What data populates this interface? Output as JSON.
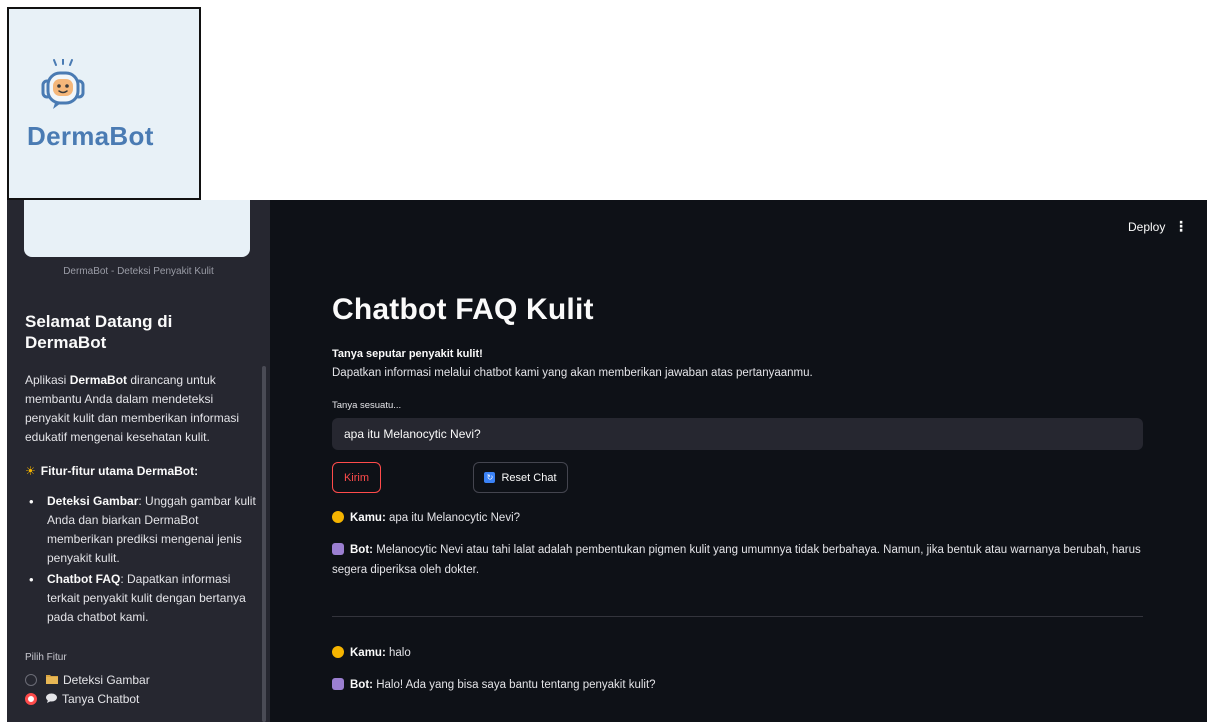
{
  "logo": {
    "text": "DermaBot"
  },
  "sidebar": {
    "caption": "DermaBot - Deteksi Penyakit Kulit",
    "welcome_line1": "Selamat Datang di",
    "welcome_line2": "DermaBot",
    "intro_pre": "Aplikasi ",
    "intro_brand": "DermaBot",
    "intro_post": " dirancang untuk membantu Anda dalam mendeteksi penyakit kulit dan memberikan informasi edukatif mengenai kesehatan kulit.",
    "features_icon": "☀",
    "features_heading": "Fitur-fitur utama DermaBot:",
    "features": [
      {
        "title": "Deteksi Gambar",
        "desc": ": Unggah gambar kulit Anda dan biarkan DermaBot memberikan prediksi mengenai jenis penyakit kulit."
      },
      {
        "title": "Chatbot FAQ",
        "desc": ": Dapatkan informasi terkait penyakit kulit dengan bertanya pada chatbot kami."
      }
    ],
    "pick_label": "Pilih Fitur",
    "options": [
      {
        "label": "Deteksi Gambar",
        "icon": "folder-icon",
        "selected": false
      },
      {
        "label": "Tanya Chatbot",
        "icon": "speech-bubble-icon",
        "selected": true
      }
    ]
  },
  "header": {
    "deploy_label": "Deploy",
    "menu_icon": "⋮"
  },
  "main": {
    "title": "Chatbot FAQ Kulit",
    "subtitle": "Tanya seputar penyakit kulit!",
    "description": "Dapatkan informasi melalui chatbot kami yang akan memberikan jawaban atas pertanyaanmu.",
    "input_label": "Tanya sesuatu...",
    "input_value": "apa itu Melanocytic Nevi?",
    "send_label": "Kirim",
    "reset_label": "Reset Chat",
    "messages": [
      {
        "speaker": "Kamu:",
        "text": " apa itu Melanocytic Nevi?"
      },
      {
        "speaker": "Bot:",
        "text": " Melanocytic Nevi atau tahi lalat adalah pembentukan pigmen kulit yang umumnya tidak berbahaya. Namun, jika bentuk atau warnanya berubah, harus segera diperiksa oleh dokter."
      },
      {
        "speaker": "Kamu:",
        "text": " halo"
      },
      {
        "speaker": "Bot:",
        "text": " Halo! Ada yang bisa saya bantu tentang penyakit kulit?"
      }
    ]
  },
  "colors": {
    "accent": "#ff4b4b",
    "app_bg": "#0e1117",
    "sidebar_bg": "#262730",
    "logo_blue": "#4a7bb3"
  }
}
